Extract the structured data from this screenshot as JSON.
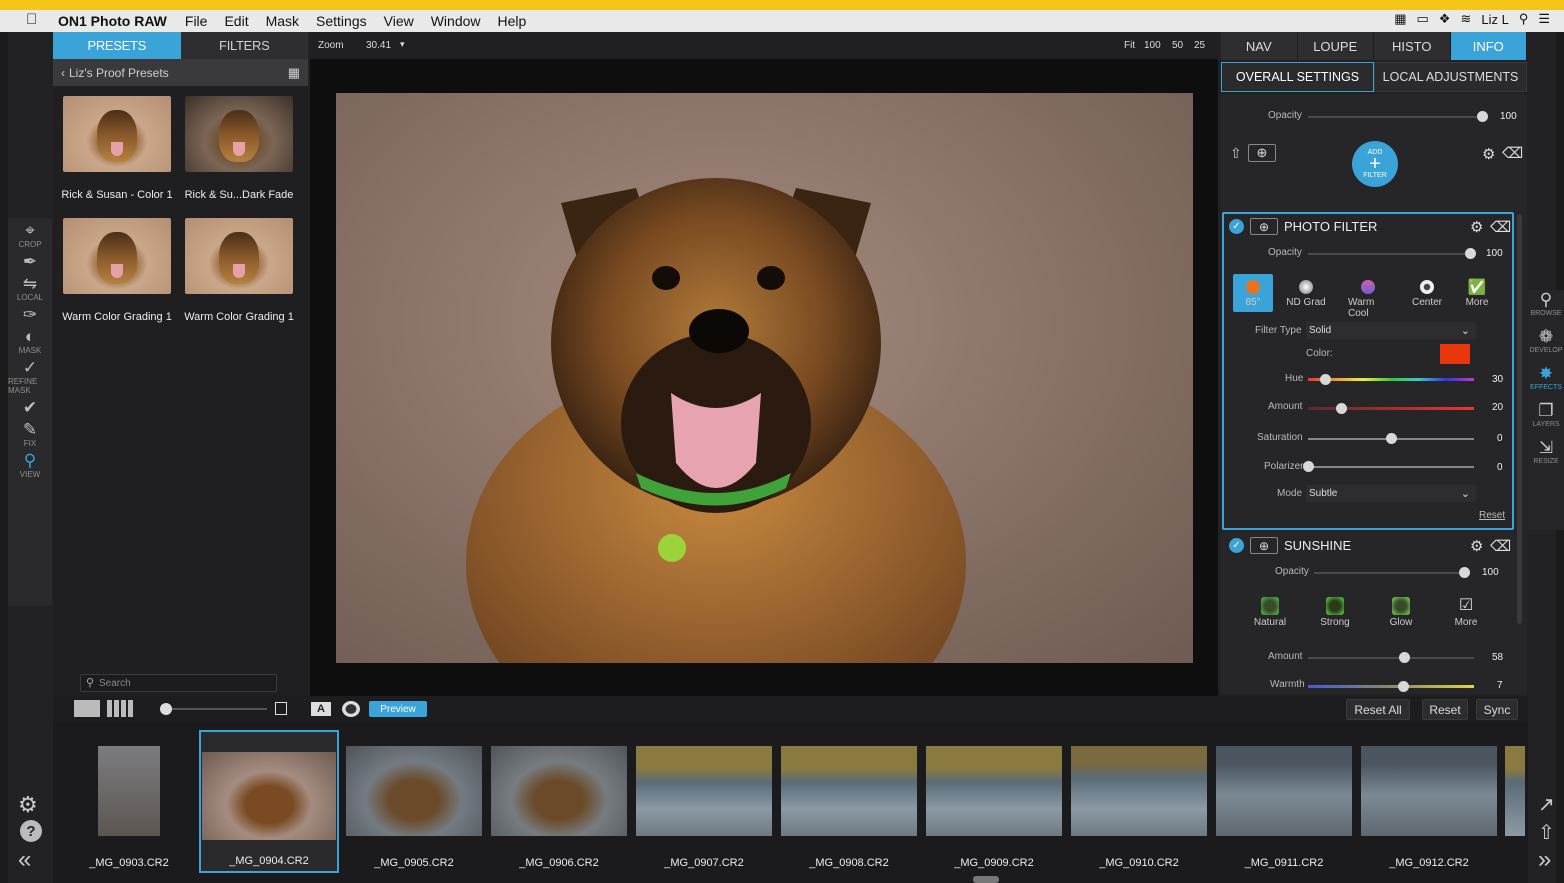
{
  "menubar": {
    "apple_icon": "apple-logo",
    "app_name": "ON1 Photo RAW",
    "items": [
      "File",
      "Edit",
      "Mask",
      "Settings",
      "View",
      "Window",
      "Help"
    ],
    "user": "Liz L"
  },
  "presets_panel": {
    "tabs": [
      "PRESETS",
      "FILTERS"
    ],
    "active_tab": "PRESETS",
    "breadcrumb": "Liz's Proof Presets",
    "presets": [
      {
        "label": "Rick & Susan - Color 1"
      },
      {
        "label": "Rick & Su...Dark Fade"
      },
      {
        "label": "Warm Color Grading 1"
      },
      {
        "label": "Warm Color Grading 1"
      }
    ],
    "search_placeholder": "Search"
  },
  "tools": [
    {
      "icon": "crop-icon",
      "label": "CROP"
    },
    {
      "icon": "brush-icon",
      "label": ""
    },
    {
      "icon": "local-icon",
      "label": "LOCAL"
    },
    {
      "icon": "masking-brush-icon",
      "label": ""
    },
    {
      "icon": "mask-icon",
      "label": "MASK"
    },
    {
      "icon": "refine-brush-icon",
      "label": "REFINE MASK"
    },
    {
      "icon": "retouch-icon",
      "label": ""
    },
    {
      "icon": "fix-icon",
      "label": "FIX"
    },
    {
      "icon": "view-icon",
      "label": "VIEW"
    }
  ],
  "center_toolbar": {
    "zoom_label": "Zoom",
    "zoom_value": "30.41",
    "fit_options": [
      "Fit",
      "100",
      "50",
      "25"
    ]
  },
  "right_tabs": [
    "NAV",
    "LOUPE",
    "HISTO",
    "INFO"
  ],
  "right_active_tab": "INFO",
  "settings_tabs": [
    "OVERALL SETTINGS",
    "LOCAL ADJUSTMENTS"
  ],
  "settings_active_tab": "OVERALL SETTINGS",
  "overall": {
    "opacity_label": "Opacity",
    "opacity_value": "100",
    "opacity_level": 1.0,
    "add_filter_top": "ADD",
    "add_filter_bottom": "FILTER"
  },
  "photo_filter": {
    "title": "PHOTO FILTER",
    "opacity_label": "Opacity",
    "opacity_value": "100",
    "opacity_level": 1.0,
    "presets": [
      {
        "label": "85°",
        "color": "#e8731f"
      },
      {
        "label": "ND Grad",
        "color": "#e0e0e0"
      },
      {
        "label": "Warm Cool",
        "color": "#a066c0"
      },
      {
        "label": "Center",
        "color": "#e0e0e0"
      },
      {
        "label": "More",
        "color": "#e0e0e0"
      }
    ],
    "filter_type_label": "Filter Type",
    "filter_type_value": "Solid",
    "color_label": "Color:",
    "color_value": "#e8360d",
    "hue_label": "Hue",
    "hue_value": "30",
    "hue_level": 0.1,
    "amount_label": "Amount",
    "amount_value": "20",
    "amount_level": 0.2,
    "saturation_label": "Saturation",
    "saturation_value": "0",
    "saturation_level": 0.5,
    "polarizer_label": "Polarizer",
    "polarizer_value": "0",
    "polarizer_level": 0.0,
    "mode_label": "Mode",
    "mode_value": "Subtle",
    "reset_label": "Reset"
  },
  "sunshine": {
    "title": "SUNSHINE",
    "opacity_label": "Opacity",
    "opacity_value": "100",
    "opacity_level": 1.0,
    "presets": [
      {
        "label": "Natural"
      },
      {
        "label": "Strong"
      },
      {
        "label": "Glow"
      },
      {
        "label": "More"
      }
    ],
    "amount_label": "Amount",
    "amount_value": "58",
    "amount_level": 0.58,
    "warmth_label": "Warmth",
    "warmth_value": "7",
    "warmth_level": 0.57
  },
  "right_modules": [
    {
      "icon": "browse-icon",
      "label": "BROWSE"
    },
    {
      "icon": "develop-icon",
      "label": "DEVELOP"
    },
    {
      "icon": "effects-icon",
      "label": "EFFECTS"
    },
    {
      "icon": "layers-icon",
      "label": "LAYERS"
    },
    {
      "icon": "resize-icon",
      "label": "RESIZE"
    }
  ],
  "filmbar": {
    "preview_label": "Preview",
    "a_label": "A",
    "reset_all_label": "Reset All",
    "reset_label": "Reset",
    "sync_label": "Sync"
  },
  "filmstrip": [
    {
      "name": "_MG_0903.CR2",
      "selected": false
    },
    {
      "name": "_MG_0904.CR2",
      "selected": true
    },
    {
      "name": "_MG_0905.CR2",
      "selected": false
    },
    {
      "name": "_MG_0906.CR2",
      "selected": false
    },
    {
      "name": "_MG_0907.CR2",
      "selected": false
    },
    {
      "name": "_MG_0908.CR2",
      "selected": false
    },
    {
      "name": "_MG_0909.CR2",
      "selected": false
    },
    {
      "name": "_MG_0910.CR2",
      "selected": false
    },
    {
      "name": "_MG_0911.CR2",
      "selected": false
    },
    {
      "name": "_MG_0912.CR2",
      "selected": false
    }
  ]
}
